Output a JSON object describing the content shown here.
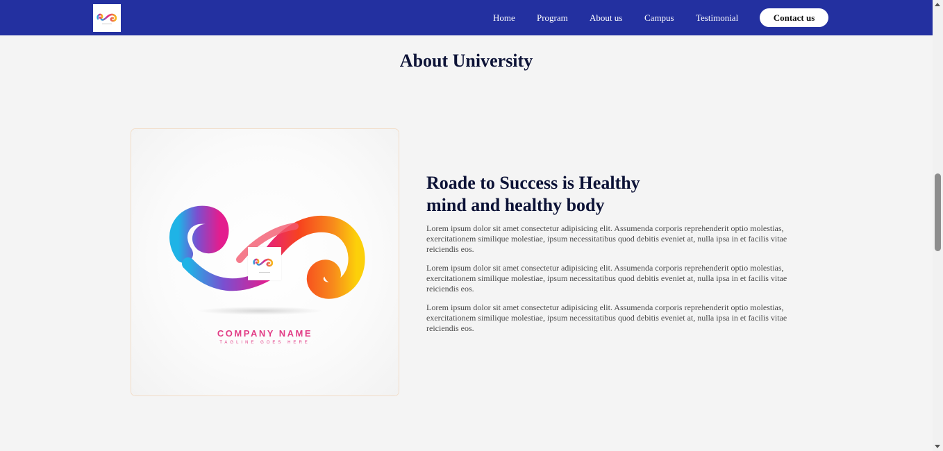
{
  "nav": {
    "links": [
      "Home",
      "Program",
      "About us",
      "Campus",
      "Testimonial"
    ],
    "contact_label": "Contact us",
    "bg_color": "#2330a0"
  },
  "main": {
    "title": "About University",
    "image_card": {
      "company_name": "COMPANY NAME",
      "tagline": "TAGLINE GOES HERE"
    },
    "heading": "Roade to Success is Healthy mind and healthy body",
    "paragraphs": [
      "Lorem ipsum dolor sit amet consectetur adipisicing elit. Assumenda corporis reprehenderit optio molestias, exercitationem similique molestiae, ipsum necessitatibus quod debitis eveniet at, nulla ipsa in et facilis vitae reiciendis eos.",
      "Lorem ipsum dolor sit amet consectetur adipisicing elit. Assumenda corporis reprehenderit optio molestias, exercitationem similique molestiae, ipsum necessitatibus quod debitis eveniet at, nulla ipsa in et facilis vitae reiciendis eos.",
      "Lorem ipsum dolor sit amet consectetur adipisicing elit. Assumenda corporis reprehenderit optio molestias, exercitationem similique molestiae, ipsum necessitatibus quod debitis eveniet at, nulla ipsa in et facilis vitae reiciendis eos."
    ]
  },
  "icons": {
    "logo": "infinity-swirl-logo-icon",
    "scroll_up": "chevron-up-icon",
    "scroll_down": "chevron-down-icon"
  }
}
